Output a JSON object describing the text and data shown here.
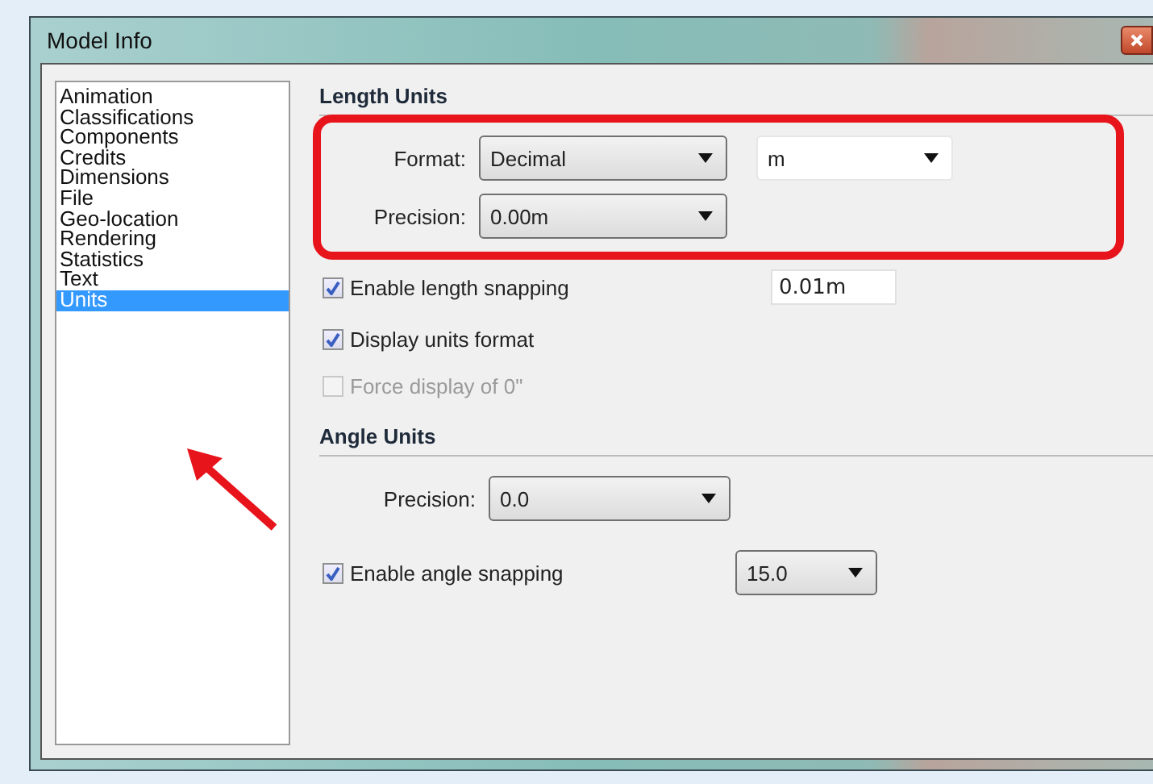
{
  "window": {
    "title": "Model Info"
  },
  "sidebar": {
    "items": [
      {
        "label": "Animation",
        "selected": false
      },
      {
        "label": "Classifications",
        "selected": false
      },
      {
        "label": "Components",
        "selected": false
      },
      {
        "label": "Credits",
        "selected": false
      },
      {
        "label": "Dimensions",
        "selected": false
      },
      {
        "label": "File",
        "selected": false
      },
      {
        "label": "Geo-location",
        "selected": false
      },
      {
        "label": "Rendering",
        "selected": false
      },
      {
        "label": "Statistics",
        "selected": false
      },
      {
        "label": "Text",
        "selected": false
      },
      {
        "label": "Units",
        "selected": true
      }
    ]
  },
  "length_units": {
    "title": "Length Units",
    "format": {
      "label": "Format:",
      "value": "Decimal",
      "kind": "combo"
    },
    "unit": {
      "value": "m",
      "kind": "plain"
    },
    "precision": {
      "label": "Precision:",
      "value": "0.00m",
      "kind": "combo"
    },
    "checkboxes": [
      {
        "label": "Enable length snapping",
        "checked": true,
        "disabled": false,
        "value": "0.01m"
      },
      {
        "label": "Display units format",
        "checked": true,
        "disabled": false
      },
      {
        "label": "Force display of 0\"",
        "checked": false,
        "disabled": true
      }
    ]
  },
  "angle_units": {
    "title": "Angle Units",
    "precision": {
      "label": "Precision:",
      "value": "0.0",
      "kind": "combo"
    },
    "snapping": {
      "label": "Enable angle snapping",
      "checked": true,
      "disabled": false,
      "value": "15.0",
      "kind": "combo"
    }
  }
}
